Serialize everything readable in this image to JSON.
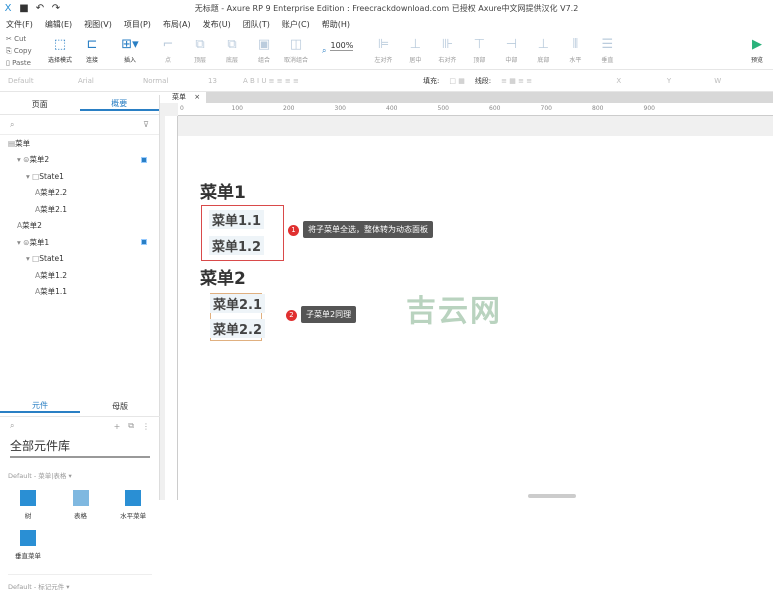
{
  "window": {
    "title": "无标题 - Axure RP 9 Enterprise Edition : Freecrackdownload.com 已授权    Axure中文网提供汉化 V7.2"
  },
  "menu": [
    "文件(F)",
    "编辑(E)",
    "视图(V)",
    "项目(P)",
    "布局(A)",
    "发布(U)",
    "团队(T)",
    "账户(C)",
    "帮助(H)"
  ],
  "clipboard": [
    "Cut",
    "Copy",
    "Paste"
  ],
  "toolbar": {
    "select": "选择模式",
    "connect": "连接",
    "insert": "插入",
    "point": "点",
    "top": "顶层",
    "bottom": "底层",
    "group": "组合",
    "ungroup": "取消组合",
    "zoom": "100%",
    "left": "左对齐",
    "center": "居中",
    "right": "右对齐",
    "top_align": "顶部",
    "middle": "中部",
    "bottom_align": "底部",
    "horizontal": "水平",
    "vertical": "垂直",
    "preview": "预览"
  },
  "format": {
    "style": "Default",
    "font": "Arial",
    "weight": "Normal",
    "size": "13",
    "fill": "填充:",
    "border": "线段:",
    "x": "X",
    "y": "Y",
    "w": "W"
  },
  "left": {
    "tabs": [
      "页面",
      "概要"
    ],
    "tree": [
      {
        "label": "菜单",
        "indent": 0
      },
      {
        "label": "菜单2",
        "indent": 1,
        "selected": true
      },
      {
        "label": "State1",
        "indent": 2
      },
      {
        "label": "菜单2.2",
        "indent": 3
      },
      {
        "label": "菜单2.1",
        "indent": 3
      },
      {
        "label": "菜单2",
        "indent": 1
      },
      {
        "label": "菜单1",
        "indent": 1,
        "selected": true
      },
      {
        "label": "State1",
        "indent": 2
      },
      {
        "label": "菜单1.2",
        "indent": 3
      },
      {
        "label": "菜单1.1",
        "indent": 3
      }
    ],
    "lib_tabs": [
      "元件",
      "母版"
    ],
    "library": "全部元件库",
    "group1": "Default - 菜单|表格 ▾",
    "items": [
      "树",
      "表格",
      "水平菜单",
      "垂直菜单"
    ],
    "group2": "Default - 标记元件 ▾"
  },
  "canvas": {
    "tab": "菜单",
    "ruler": [
      "0",
      "100",
      "200",
      "300",
      "400",
      "500",
      "600",
      "700",
      "800",
      "900"
    ],
    "menu1": "菜单1",
    "m11": "菜单1.1",
    "m12": "菜单1.2",
    "menu2": "菜单2",
    "m21": "菜单2.1",
    "m22": "菜单2.2",
    "note1_num": "1",
    "note1": "将子菜单全选，整体转为动态面板",
    "note2_num": "2",
    "note2": "子菜单2同理",
    "watermark": "吉云网"
  }
}
